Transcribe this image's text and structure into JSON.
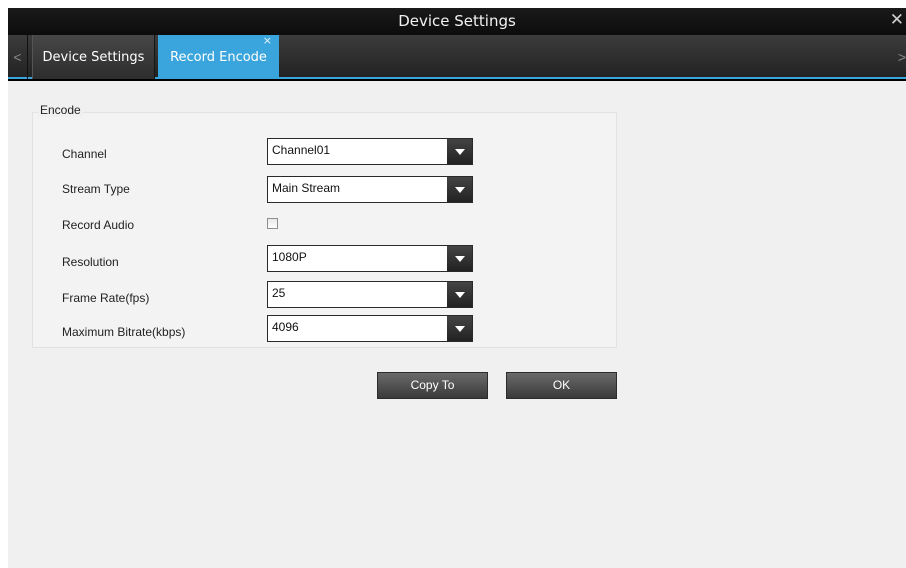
{
  "window": {
    "title": "Device Settings",
    "close_glyph": "✕"
  },
  "tabs": {
    "left_arrow": "<",
    "right_arrow": ">",
    "items": [
      {
        "label": "Device Settings",
        "active": false
      },
      {
        "label": "Record Encode",
        "active": true,
        "close_glyph": "×"
      }
    ]
  },
  "encode": {
    "group_label": "Encode",
    "fields": {
      "channel": {
        "label": "Channel",
        "value": "Channel01"
      },
      "stream_type": {
        "label": "Stream Type",
        "value": "Main Stream"
      },
      "record_audio": {
        "label": "Record Audio",
        "checked": false
      },
      "resolution": {
        "label": "Resolution",
        "value": "1080P"
      },
      "frame_rate": {
        "label": "Frame Rate(fps)",
        "value": "25"
      },
      "max_bitrate": {
        "label": "Maximum Bitrate(kbps)",
        "value": "4096"
      }
    }
  },
  "actions": {
    "copy_to": "Copy To",
    "ok": "OK"
  },
  "colors": {
    "accent": "#3aa5dd",
    "content_bg": "#f0f0f0",
    "titlebar_bg": "#0c0c0c"
  }
}
